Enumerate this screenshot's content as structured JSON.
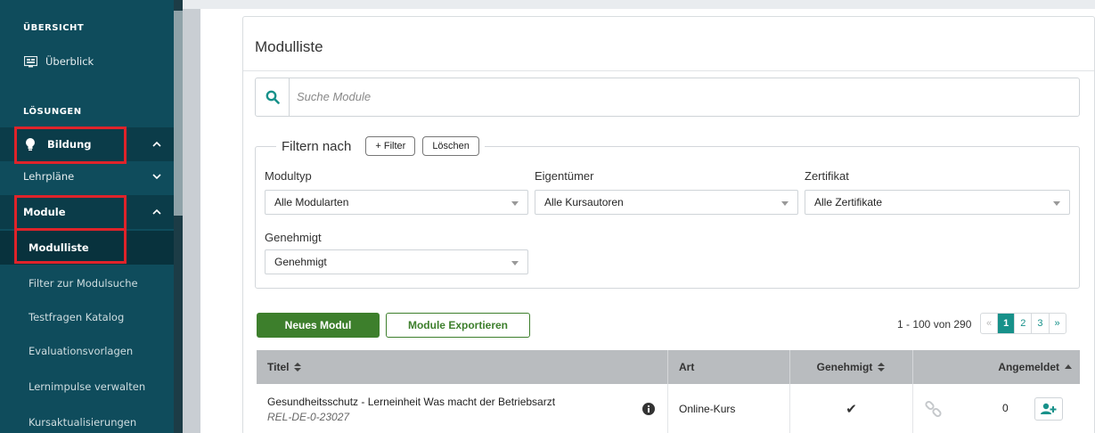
{
  "sidebar": {
    "section_overview": "ÜBERSICHT",
    "overview_item": "Überblick",
    "section_solutions": "LÖSUNGEN",
    "items": [
      {
        "label": "Bildung"
      },
      {
        "label": "Lehrpläne"
      },
      {
        "label": "Module"
      },
      {
        "label": "Modulliste"
      },
      {
        "label": "Filter zur Modulsuche"
      },
      {
        "label": "Testfragen Katalog"
      },
      {
        "label": "Evaluationsvorlagen"
      },
      {
        "label": "Lernimpulse verwalten"
      },
      {
        "label": "Kursaktualisierungen"
      }
    ]
  },
  "main": {
    "title": "Modulliste",
    "search_placeholder": "Suche Module",
    "filter": {
      "legend": "Filtern nach",
      "add_filter": "+ Filter",
      "clear": "Löschen",
      "fields": [
        {
          "label": "Modultyp",
          "value": "Alle Modularten"
        },
        {
          "label": "Eigentümer",
          "value": "Alle Kursautoren"
        },
        {
          "label": "Zertifikat",
          "value": "Alle Zertifikate"
        },
        {
          "label": "Genehmigt",
          "value": "Genehmigt"
        }
      ]
    },
    "actions": {
      "new_module": "Neues Modul",
      "export_modules": "Module Exportieren"
    },
    "pagination": {
      "info": "1 - 100 von 290",
      "prev": "«",
      "pages": [
        "1",
        "2",
        "3"
      ],
      "next": "»",
      "current": "1"
    },
    "table": {
      "headers": [
        "Titel",
        "Art",
        "Genehmigt",
        "Angemeldet"
      ],
      "rows": [
        {
          "title": "Gesundheitsschutz - Lerneinheit Was macht der Betriebsarzt",
          "code": "REL-DE-0-23027",
          "type": "Online-Kurs",
          "approved": "✔",
          "enrolled": "0"
        }
      ]
    }
  },
  "colors": {
    "sidebar_bg": "#0f4c5c",
    "primary_green": "#3d7f2c",
    "teal": "#17918a",
    "highlight_red": "#e0232a"
  }
}
